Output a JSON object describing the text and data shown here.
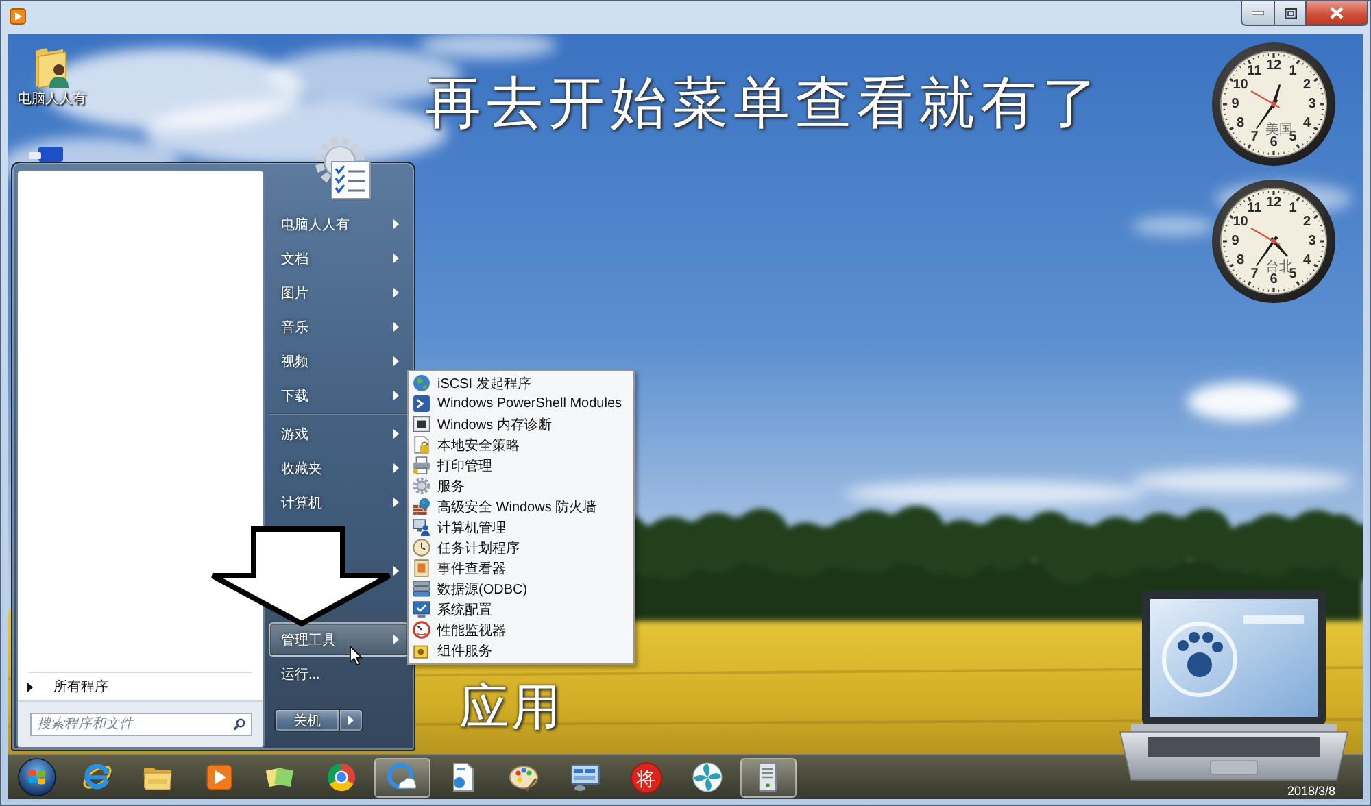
{
  "desktop": {
    "icons": [
      {
        "label": "电脑人人有"
      }
    ],
    "heading_caption": "再去开始菜单查看就有了",
    "bottom_caption": "应用"
  },
  "gadgets": {
    "clocks": [
      {
        "city": "美国",
        "numerals": [
          "12",
          "11",
          "1",
          "10",
          "2",
          "9",
          "3",
          "8",
          "4",
          "7",
          "5",
          "6"
        ]
      },
      {
        "city": "台北",
        "numerals": [
          "12",
          "11",
          "1",
          "10",
          "2",
          "9",
          "3",
          "8",
          "4",
          "7",
          "5",
          "6"
        ]
      }
    ]
  },
  "start_menu": {
    "all_programs": "所有程序",
    "search": {
      "placeholder": "搜索程序和文件"
    },
    "items": [
      {
        "kind": "link",
        "label": "电脑人人有",
        "submenu": true,
        "selected": false
      },
      {
        "kind": "link",
        "label": "文档",
        "submenu": true,
        "selected": false
      },
      {
        "kind": "link",
        "label": "图片",
        "submenu": true,
        "selected": false
      },
      {
        "kind": "link",
        "label": "音乐",
        "submenu": true,
        "selected": false
      },
      {
        "kind": "link",
        "label": "视频",
        "submenu": true,
        "selected": false
      },
      {
        "kind": "link",
        "label": "下载",
        "submenu": true,
        "selected": false
      },
      {
        "kind": "separator"
      },
      {
        "kind": "link",
        "label": "游戏",
        "submenu": true,
        "selected": false
      },
      {
        "kind": "link",
        "label": "收藏夹",
        "submenu": true,
        "selected": false
      },
      {
        "kind": "link",
        "label": "计算机",
        "submenu": true,
        "selected": false
      },
      {
        "kind": "covered"
      },
      {
        "kind": "covered",
        "submenu": true
      },
      {
        "kind": "covered"
      },
      {
        "kind": "link",
        "label": "管理工具",
        "submenu": true,
        "selected": true
      },
      {
        "kind": "link",
        "label": "运行...",
        "submenu": false,
        "selected": false
      }
    ],
    "shutdown": {
      "label": "关机"
    }
  },
  "submenu": {
    "items": [
      {
        "label": "iSCSI 发起程序"
      },
      {
        "label": "Windows PowerShell Modules"
      },
      {
        "label": "Windows 内存诊断"
      },
      {
        "label": "本地安全策略"
      },
      {
        "label": "打印管理"
      },
      {
        "label": "服务"
      },
      {
        "label": "高级安全 Windows 防火墙"
      },
      {
        "label": "计算机管理"
      },
      {
        "label": "任务计划程序"
      },
      {
        "label": "事件查看器"
      },
      {
        "label": "数据源(ODBC)"
      },
      {
        "label": "系统配置"
      },
      {
        "label": "性能监视器"
      },
      {
        "label": "组件服务"
      }
    ]
  },
  "taskbar": {
    "apps": [
      {
        "active": false
      },
      {
        "active": false
      },
      {
        "active": false
      },
      {
        "active": false
      },
      {
        "active": false
      },
      {
        "active": true
      },
      {
        "active": false
      },
      {
        "active": false
      },
      {
        "active": false
      },
      {
        "label": "将",
        "active": false
      },
      {
        "active": false
      },
      {
        "active": true
      }
    ],
    "date": "2018/3/8"
  }
}
